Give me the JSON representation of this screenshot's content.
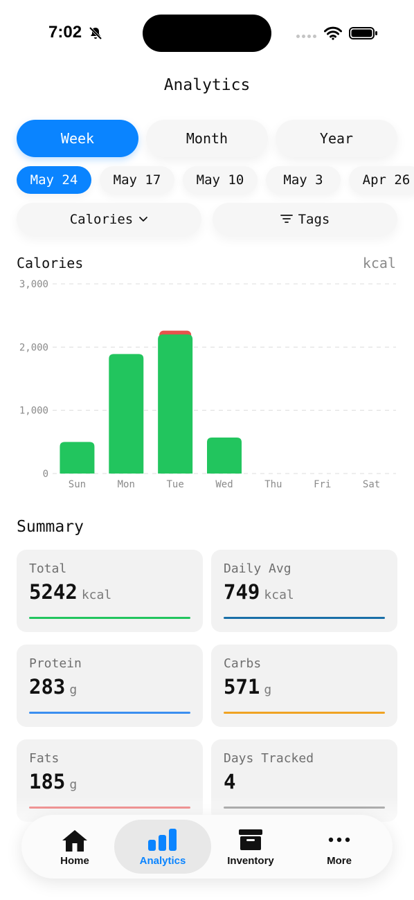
{
  "status_bar": {
    "time": "7:02",
    "icons": [
      "bell-slash-icon",
      "signal-dots-icon",
      "wifi-icon",
      "battery-icon"
    ]
  },
  "header": {
    "title": "Analytics"
  },
  "period_tabs": [
    {
      "label": "Week",
      "active": true
    },
    {
      "label": "Month",
      "active": false
    },
    {
      "label": "Year",
      "active": false
    }
  ],
  "weeks": [
    {
      "label": "May 24",
      "active": true
    },
    {
      "label": "May 17",
      "active": false
    },
    {
      "label": "May 10",
      "active": false
    },
    {
      "label": "May 3",
      "active": false
    },
    {
      "label": "Apr 26",
      "active": false
    }
  ],
  "filters": {
    "metric_label": "Calories",
    "metric_icon": "chevron-down-icon",
    "tags_label": "Tags",
    "tags_icon": "filter-lines-icon"
  },
  "chart_data": {
    "type": "bar",
    "title": "Calories",
    "unit": "kcal",
    "categories": [
      "Sun",
      "Mon",
      "Tue",
      "Wed",
      "Thu",
      "Fri",
      "Sat"
    ],
    "values": [
      500,
      1890,
      2200,
      570,
      0,
      0,
      0
    ],
    "overage": [
      0,
      0,
      0,
      0,
      0,
      0,
      0
    ],
    "overage_top_tue": 2260,
    "ylim": [
      0,
      3000
    ],
    "yticks": [
      0,
      1000,
      2000,
      3000
    ],
    "ytick_labels": [
      "0",
      "1,000",
      "2,000",
      "3,000"
    ],
    "grid": true,
    "colors": {
      "bar": "#22c55e",
      "over": "#e5534b",
      "grid": "#dcdcdc",
      "tick": "#8a8a8a"
    }
  },
  "summary": {
    "title": "Summary",
    "cards": [
      {
        "label": "Total",
        "value": "5242",
        "unit": "kcal",
        "color": "#22c55e"
      },
      {
        "label": "Daily Avg",
        "value": "749",
        "unit": "kcal",
        "color": "#1a6fa8"
      },
      {
        "label": "Protein",
        "value": "283",
        "unit": "g",
        "color": "#3b8ff0"
      },
      {
        "label": "Carbs",
        "value": "571",
        "unit": "g",
        "color": "#f0a323"
      },
      {
        "label": "Fats",
        "value": "185",
        "unit": "g",
        "color": "#e96c6c"
      },
      {
        "label": "Days Tracked",
        "value": "4",
        "unit": "",
        "color": "#8e8e8e"
      }
    ]
  },
  "tab_bar": [
    {
      "label": "Home",
      "icon": "house-icon",
      "active": false
    },
    {
      "label": "Analytics",
      "icon": "bar-chart-icon",
      "active": true
    },
    {
      "label": "Inventory",
      "icon": "archive-box-icon",
      "active": false
    },
    {
      "label": "More",
      "icon": "ellipsis-icon",
      "active": false
    }
  ]
}
